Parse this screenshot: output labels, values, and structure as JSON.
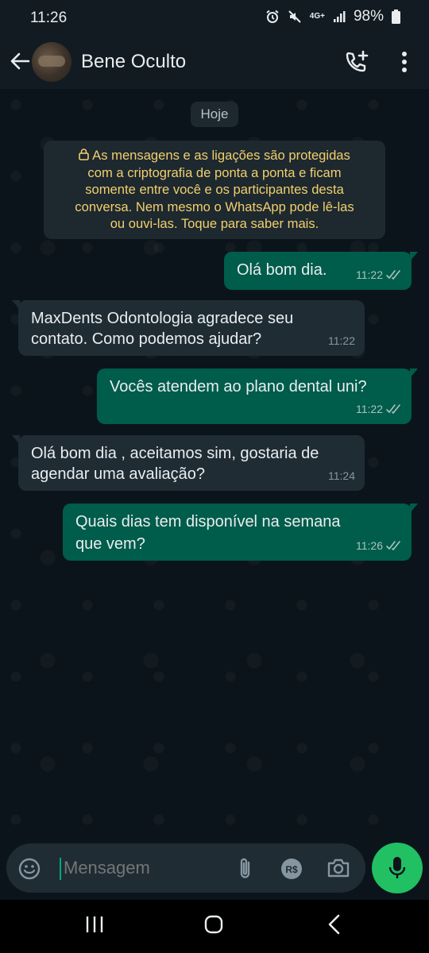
{
  "status_bar": {
    "time": "11:26",
    "network": "4G+",
    "battery": "98%",
    "icons": [
      "alarm-icon",
      "mute-icon",
      "network-4g-icon",
      "signal-icon",
      "battery-icon"
    ]
  },
  "header": {
    "contact_name": "Bene Oculto",
    "icons": [
      "back-arrow-icon",
      "add-call-icon",
      "more-options-icon"
    ]
  },
  "chat": {
    "date_chip": "Hoje",
    "encryption_notice_lines": [
      "As mensagens e as ligações são protegidas",
      "com a criptografia de ponta a ponta e ficam",
      "somente entre você e os participantes desta",
      "conversa. Nem mesmo o WhatsApp pode lê-las",
      "ou ouvi-las. Toque para saber mais."
    ],
    "messages": [
      {
        "direction": "out",
        "lines": [
          "Olá bom dia."
        ],
        "time": "11:22",
        "status": "read"
      },
      {
        "direction": "in",
        "lines": [
          "MaxDents Odontologia agradece seu",
          "contato. Como podemos ajudar?"
        ],
        "time": "11:22"
      },
      {
        "direction": "out",
        "lines": [
          "Vocês atendem ao plano dental uni?"
        ],
        "time": "11:22",
        "status": "read"
      },
      {
        "direction": "in",
        "lines": [
          "Olá bom dia , aceitamos sim, gostaria de",
          "agendar uma avaliação?"
        ],
        "time": "11:24"
      },
      {
        "direction": "out",
        "lines": [
          "Quais dias tem disponível na semana",
          "que vem?"
        ],
        "time": "11:26",
        "status": "read"
      }
    ]
  },
  "composer": {
    "placeholder": "Mensagem",
    "payment_badge": "R$",
    "icons": [
      "emoji-icon",
      "attach-icon",
      "payment-icon",
      "camera-icon",
      "mic-icon"
    ]
  },
  "colors": {
    "background": "#0b141a",
    "outgoing_bubble": "#005c4b",
    "incoming_bubble": "#1f2c34",
    "accent": "#21c063",
    "notice_text": "#f1cf6d"
  }
}
